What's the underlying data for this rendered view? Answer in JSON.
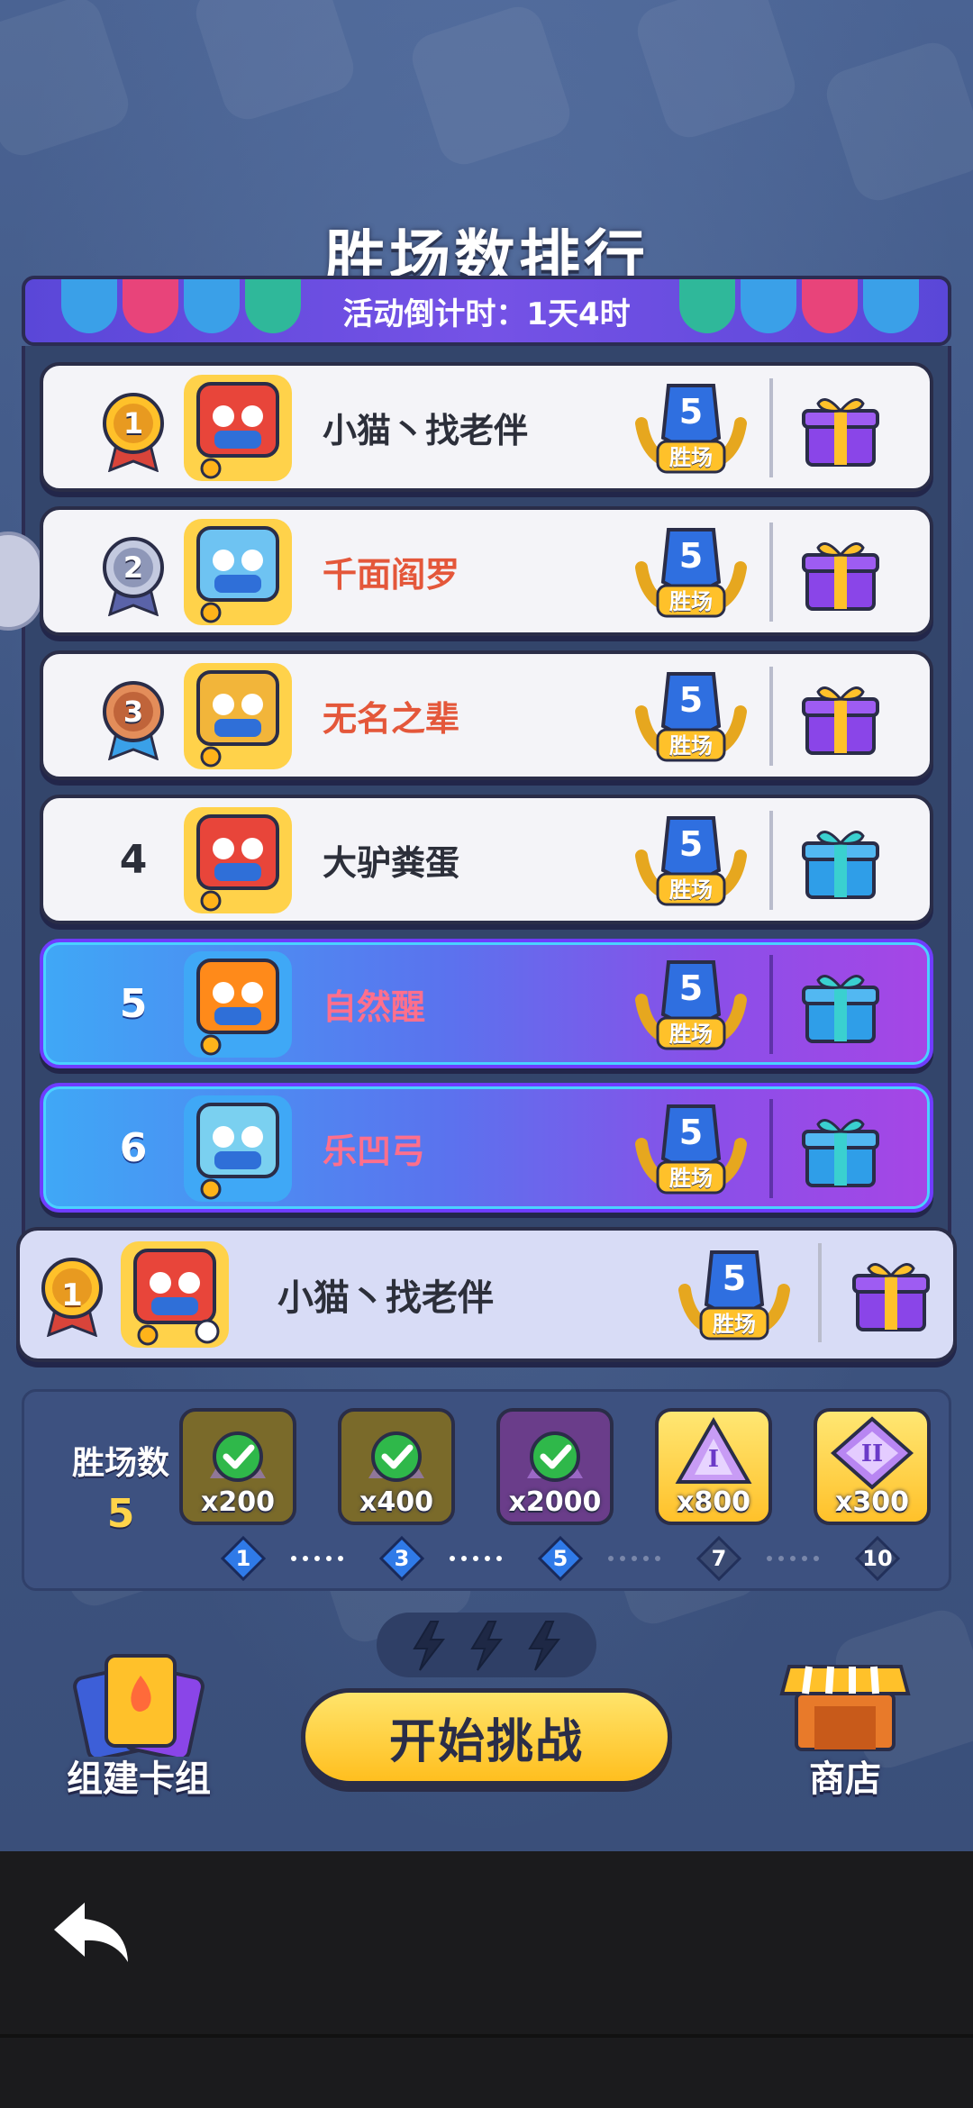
{
  "title": "胜场数排行",
  "banner": {
    "countdown": "活动倒计时：1天4时"
  },
  "badge": {
    "wins": "5",
    "label": "胜场"
  },
  "leaderboard": [
    {
      "rank": "1",
      "name": "小猫丶找老伴",
      "name_color": "#2c2f3a",
      "style": "white",
      "medal": "gold",
      "gift": "purple"
    },
    {
      "rank": "2",
      "name": "千面阎罗",
      "name_color": "#e4573a",
      "style": "white",
      "medal": "silver",
      "gift": "purple"
    },
    {
      "rank": "3",
      "name": "无名之辈",
      "name_color": "#e4573a",
      "style": "white",
      "medal": "bronze",
      "gift": "purple"
    },
    {
      "rank": "4",
      "name": "大驴粪蛋",
      "name_color": "#2c2f3a",
      "style": "white",
      "medal": "none",
      "gift": "blue"
    },
    {
      "rank": "5",
      "name": "自然醒",
      "name_color": "#ff6f8c",
      "style": "purple",
      "medal": "none",
      "gift": "blue"
    },
    {
      "rank": "6",
      "name": "乐凹弓",
      "name_color": "#ff6f8c",
      "style": "purple",
      "medal": "none",
      "gift": "blue"
    }
  ],
  "my_rank": {
    "rank": "1",
    "name": "小猫丶找老伴",
    "wins": "5",
    "label": "胜场"
  },
  "progress": {
    "label": "胜场数",
    "value": "5",
    "rewards": [
      {
        "amount": "x200",
        "claimed": true,
        "style": "done"
      },
      {
        "amount": "x400",
        "claimed": true,
        "style": "done"
      },
      {
        "amount": "x2000",
        "claimed": true,
        "style": "done-purple"
      },
      {
        "amount": "x800",
        "claimed": false,
        "style": "gold",
        "roman": "I"
      },
      {
        "amount": "x300",
        "claimed": false,
        "style": "gold",
        "roman": "II"
      }
    ],
    "steps": [
      "1",
      "3",
      "5",
      "7",
      "10"
    ],
    "current_step_index": 2
  },
  "actions": {
    "build_deck": "组建卡组",
    "start": "开始挑战",
    "shop": "商店"
  },
  "colors": {
    "accent_gold": "#ffc12a",
    "banner_purple": "#6b4fe0",
    "row_purple": "#8a4fe8",
    "background": "#3f5683"
  },
  "icons": {
    "back": "back-arrow-icon",
    "energy": "lightning-icon",
    "gift": "gift-box-icon"
  }
}
